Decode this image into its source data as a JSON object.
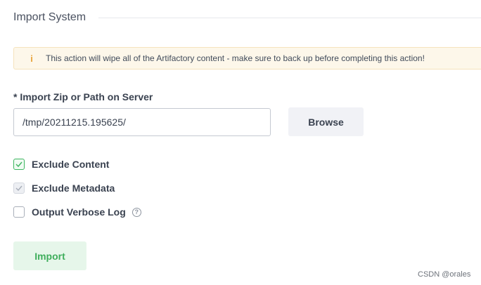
{
  "section": {
    "title": "Import System"
  },
  "alert": {
    "icon": "info-icon",
    "icon_glyph": "i",
    "text": "This action will wipe all of the Artifactory content - make sure to back up before completing this action!"
  },
  "path_field": {
    "label": "* Import Zip or Path on Server",
    "value": "/tmp/20211215.195625/"
  },
  "browse_button": {
    "label": "Browse"
  },
  "options": [
    {
      "label": "Exclude Content",
      "checked": true
    },
    {
      "label": "Exclude Metadata",
      "checked": true,
      "disabled": true
    },
    {
      "label": "Output Verbose Log",
      "checked": false,
      "help_icon": "question-circle-icon",
      "help_glyph": "?"
    }
  ],
  "import_button": {
    "label": "Import"
  },
  "watermark": "CSDN @orales",
  "colors": {
    "accent_green": "#3cb55f",
    "warning_icon": "#e8a33a",
    "warning_bg": "#fdf7ea"
  }
}
